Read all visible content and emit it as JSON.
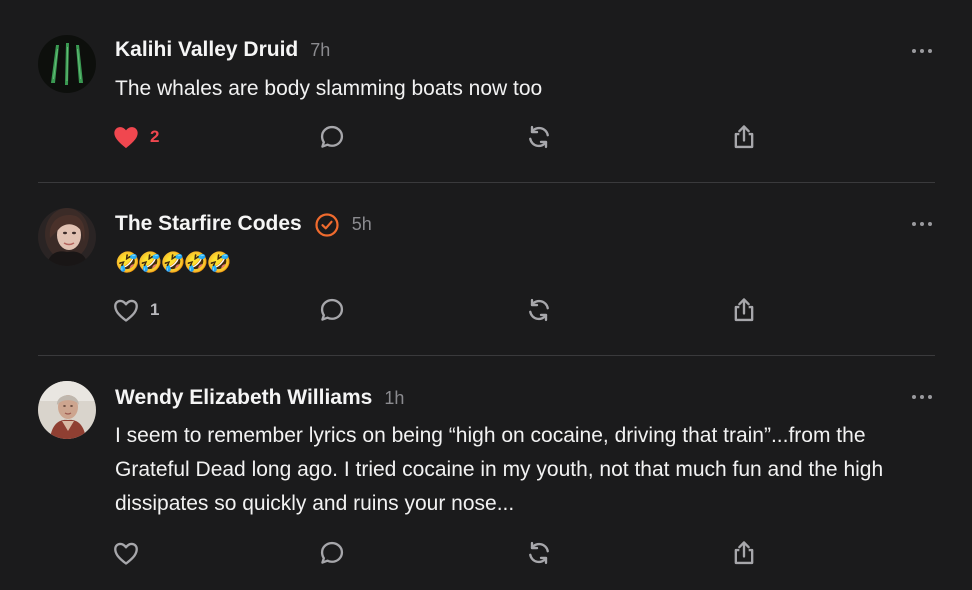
{
  "posts": [
    {
      "author": "Kalihi Valley Druid",
      "time": "7h",
      "verified": false,
      "text": "The whales are body slamming boats now too",
      "likes": "2",
      "liked": true,
      "avatar_icon": "green-feathers-avatar"
    },
    {
      "author": "The Starfire Codes",
      "time": "5h",
      "verified": true,
      "text": "🤣🤣🤣🤣🤣",
      "likes": "1",
      "liked": false,
      "avatar_icon": "woman-portrait-avatar"
    },
    {
      "author": "Wendy Elizabeth Williams",
      "time": "1h",
      "verified": false,
      "text": "I seem to remember lyrics on being “high on cocaine, driving that train”...from the Grateful Dead long ago. I tried cocaine in my youth, not that much fun and the high dissipates so quickly and ruins your nose...",
      "likes": "",
      "liked": false,
      "avatar_icon": "older-woman-portrait-avatar"
    }
  ],
  "colors": {
    "background": "#1b1b1c",
    "liked": "#f0474f",
    "verified": "#f06b2e",
    "muted": "#8b8b8f",
    "divider": "#3a3a3c"
  },
  "icons": {
    "like": "heart-icon",
    "reply": "comment-bubble-icon",
    "repost": "repost-arrows-icon",
    "share": "share-upload-icon",
    "more": "ellipsis-icon",
    "verified": "verified-check-badge-icon"
  }
}
